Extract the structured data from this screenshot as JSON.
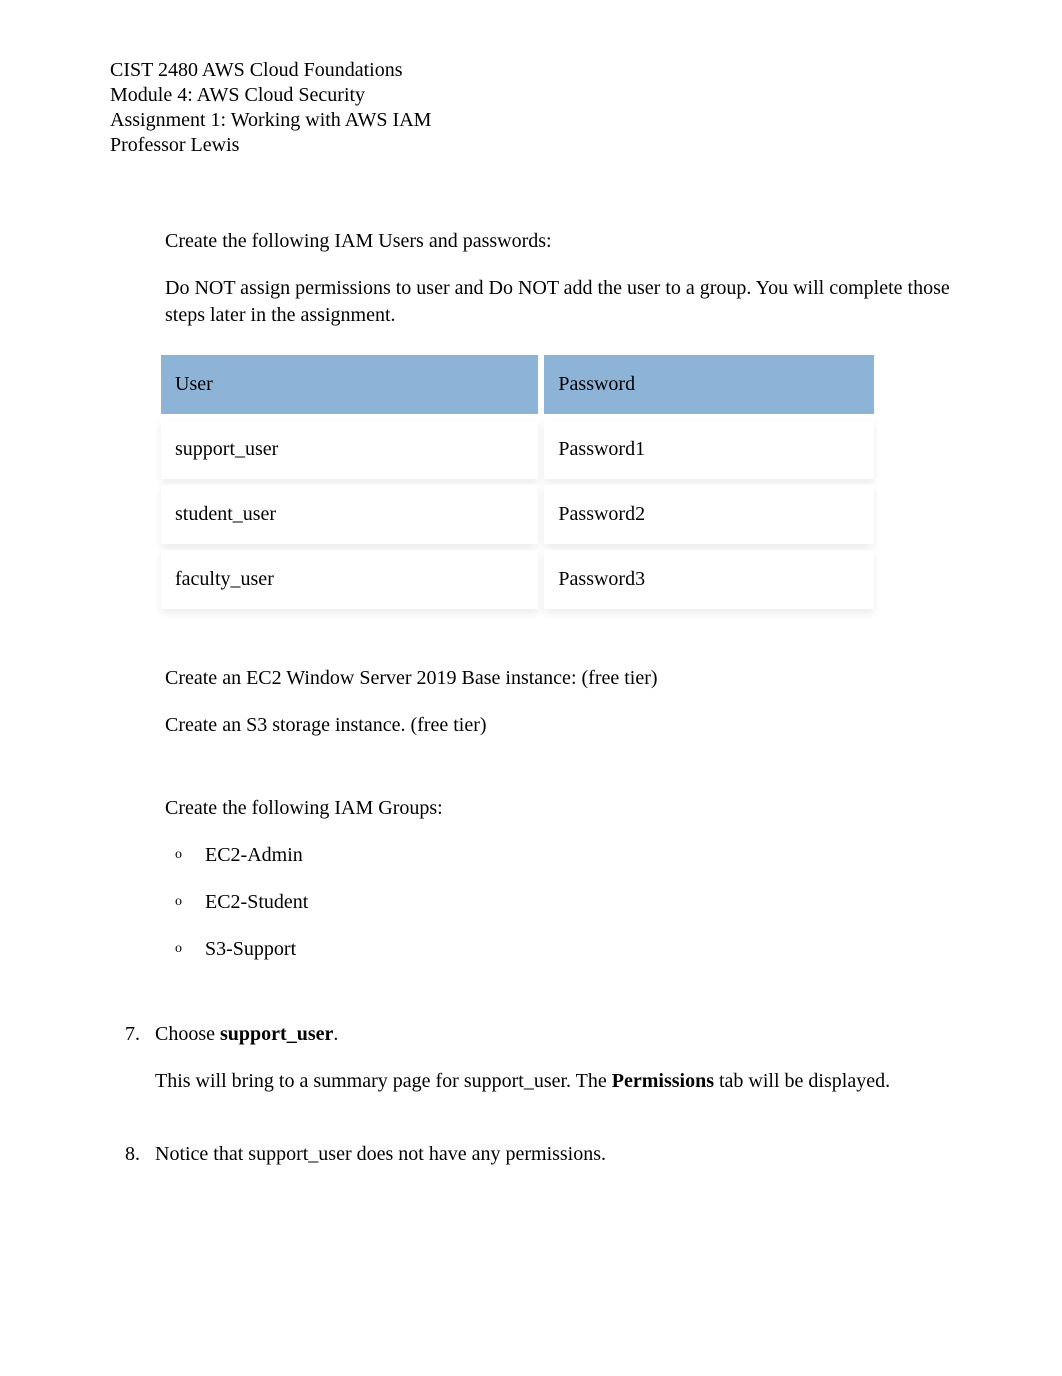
{
  "header": {
    "line1": "CIST 2480 AWS Cloud Foundations",
    "line2": "Module 4: AWS Cloud Security",
    "line3": "Assignment 1:  Working with AWS IAM",
    "line4": "Professor Lewis"
  },
  "body": {
    "p1": "Create the following IAM Users and passwords:",
    "p2": "Do NOT assign permissions to user and Do NOT add the user to a group.  You will complete those steps later in the assignment.",
    "table": {
      "headers": {
        "col1": "User",
        "col2": "Password"
      },
      "rows": [
        {
          "user": "support_user",
          "password": "Password1"
        },
        {
          "user": "student_user",
          "password": "Password2"
        },
        {
          "user": "faculty_user",
          "password": "Password3"
        }
      ]
    },
    "p3": "Create an EC2 Window Server 2019 Base instance: (free tier)",
    "p4": "Create an S3 storage instance. (free tier)",
    "p5": "Create the following IAM Groups:",
    "groups": [
      "EC2-Admin",
      "EC2-Student",
      "S3-Support"
    ],
    "step7": {
      "num": "7.",
      "lead": "Choose ",
      "bold": "support_user",
      "trail": ".",
      "sub_a": "This will bring to a summary page for support_user. The ",
      "sub_bold": "Permissions",
      "sub_b": " tab will be displayed."
    },
    "step8": {
      "num": "8.",
      "text": "Notice that support_user does not have any permissions."
    }
  }
}
